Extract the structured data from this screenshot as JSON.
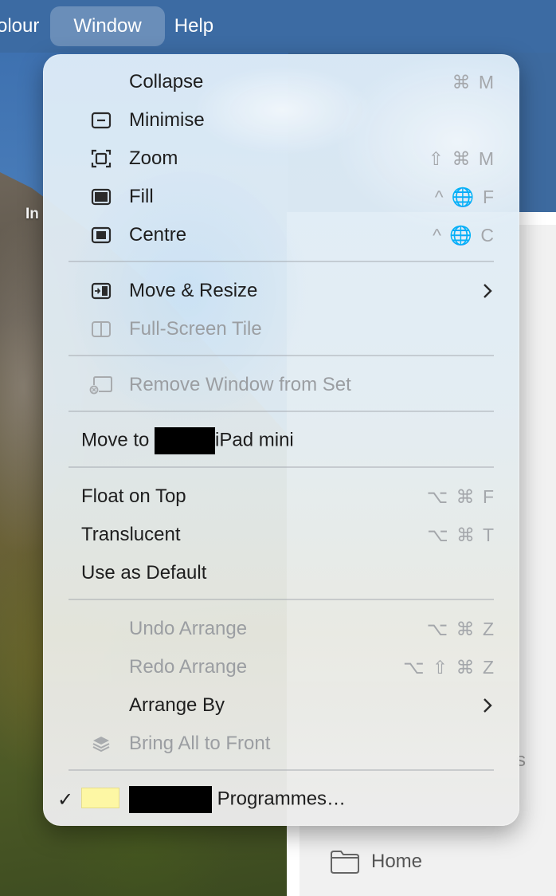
{
  "menubar": {
    "items": [
      {
        "label": "olour"
      },
      {
        "label": "Window"
      },
      {
        "label": "Help"
      }
    ]
  },
  "background": {
    "desktop_label": "In",
    "sidebar_home_label": "Home",
    "sidebar_fragment": "s"
  },
  "menu": {
    "collapse": {
      "label": "Collapse",
      "shortcut": "⌘ M"
    },
    "minimise": {
      "label": "Minimise",
      "icon": "minimise-icon"
    },
    "zoom": {
      "label": "Zoom",
      "shortcut": "⇧ ⌘ M",
      "icon": "zoom-icon"
    },
    "fill": {
      "label": "Fill",
      "shortcut": "^ 🌐 F",
      "icon": "fill-icon"
    },
    "centre": {
      "label": "Centre",
      "shortcut": "^ 🌐 C",
      "icon": "centre-icon"
    },
    "move_resize": {
      "label": "Move & Resize",
      "icon": "move-resize-icon"
    },
    "full_screen_tile": {
      "label": "Full-Screen Tile",
      "icon": "full-screen-tile-icon"
    },
    "remove_from_set": {
      "label": "Remove Window from Set",
      "icon": "remove-window-icon"
    },
    "move_to": {
      "prefix": "Move to",
      "suffix": "iPad mini"
    },
    "float_on_top": {
      "label": "Float on Top",
      "shortcut": "⌥ ⌘ F"
    },
    "translucent": {
      "label": "Translucent",
      "shortcut": "⌥ ⌘ T"
    },
    "use_as_default": {
      "label": "Use as Default"
    },
    "undo_arrange": {
      "label": "Undo Arrange",
      "shortcut": "⌥ ⌘ Z"
    },
    "redo_arrange": {
      "label": "Redo Arrange",
      "shortcut": "⌥ ⇧ ⌘ Z"
    },
    "arrange_by": {
      "label": "Arrange By"
    },
    "bring_all_to_front": {
      "label": "Bring All to Front",
      "icon": "layers-icon"
    },
    "window_entry": {
      "check": "✓",
      "suffix": "Programmes…",
      "swatch_color": "#fdf7a4"
    }
  },
  "colors": {
    "menubar": "#3c6ba3",
    "disabled_text": "#9b9ea2",
    "shortcut_text": "#a4a7ab"
  }
}
